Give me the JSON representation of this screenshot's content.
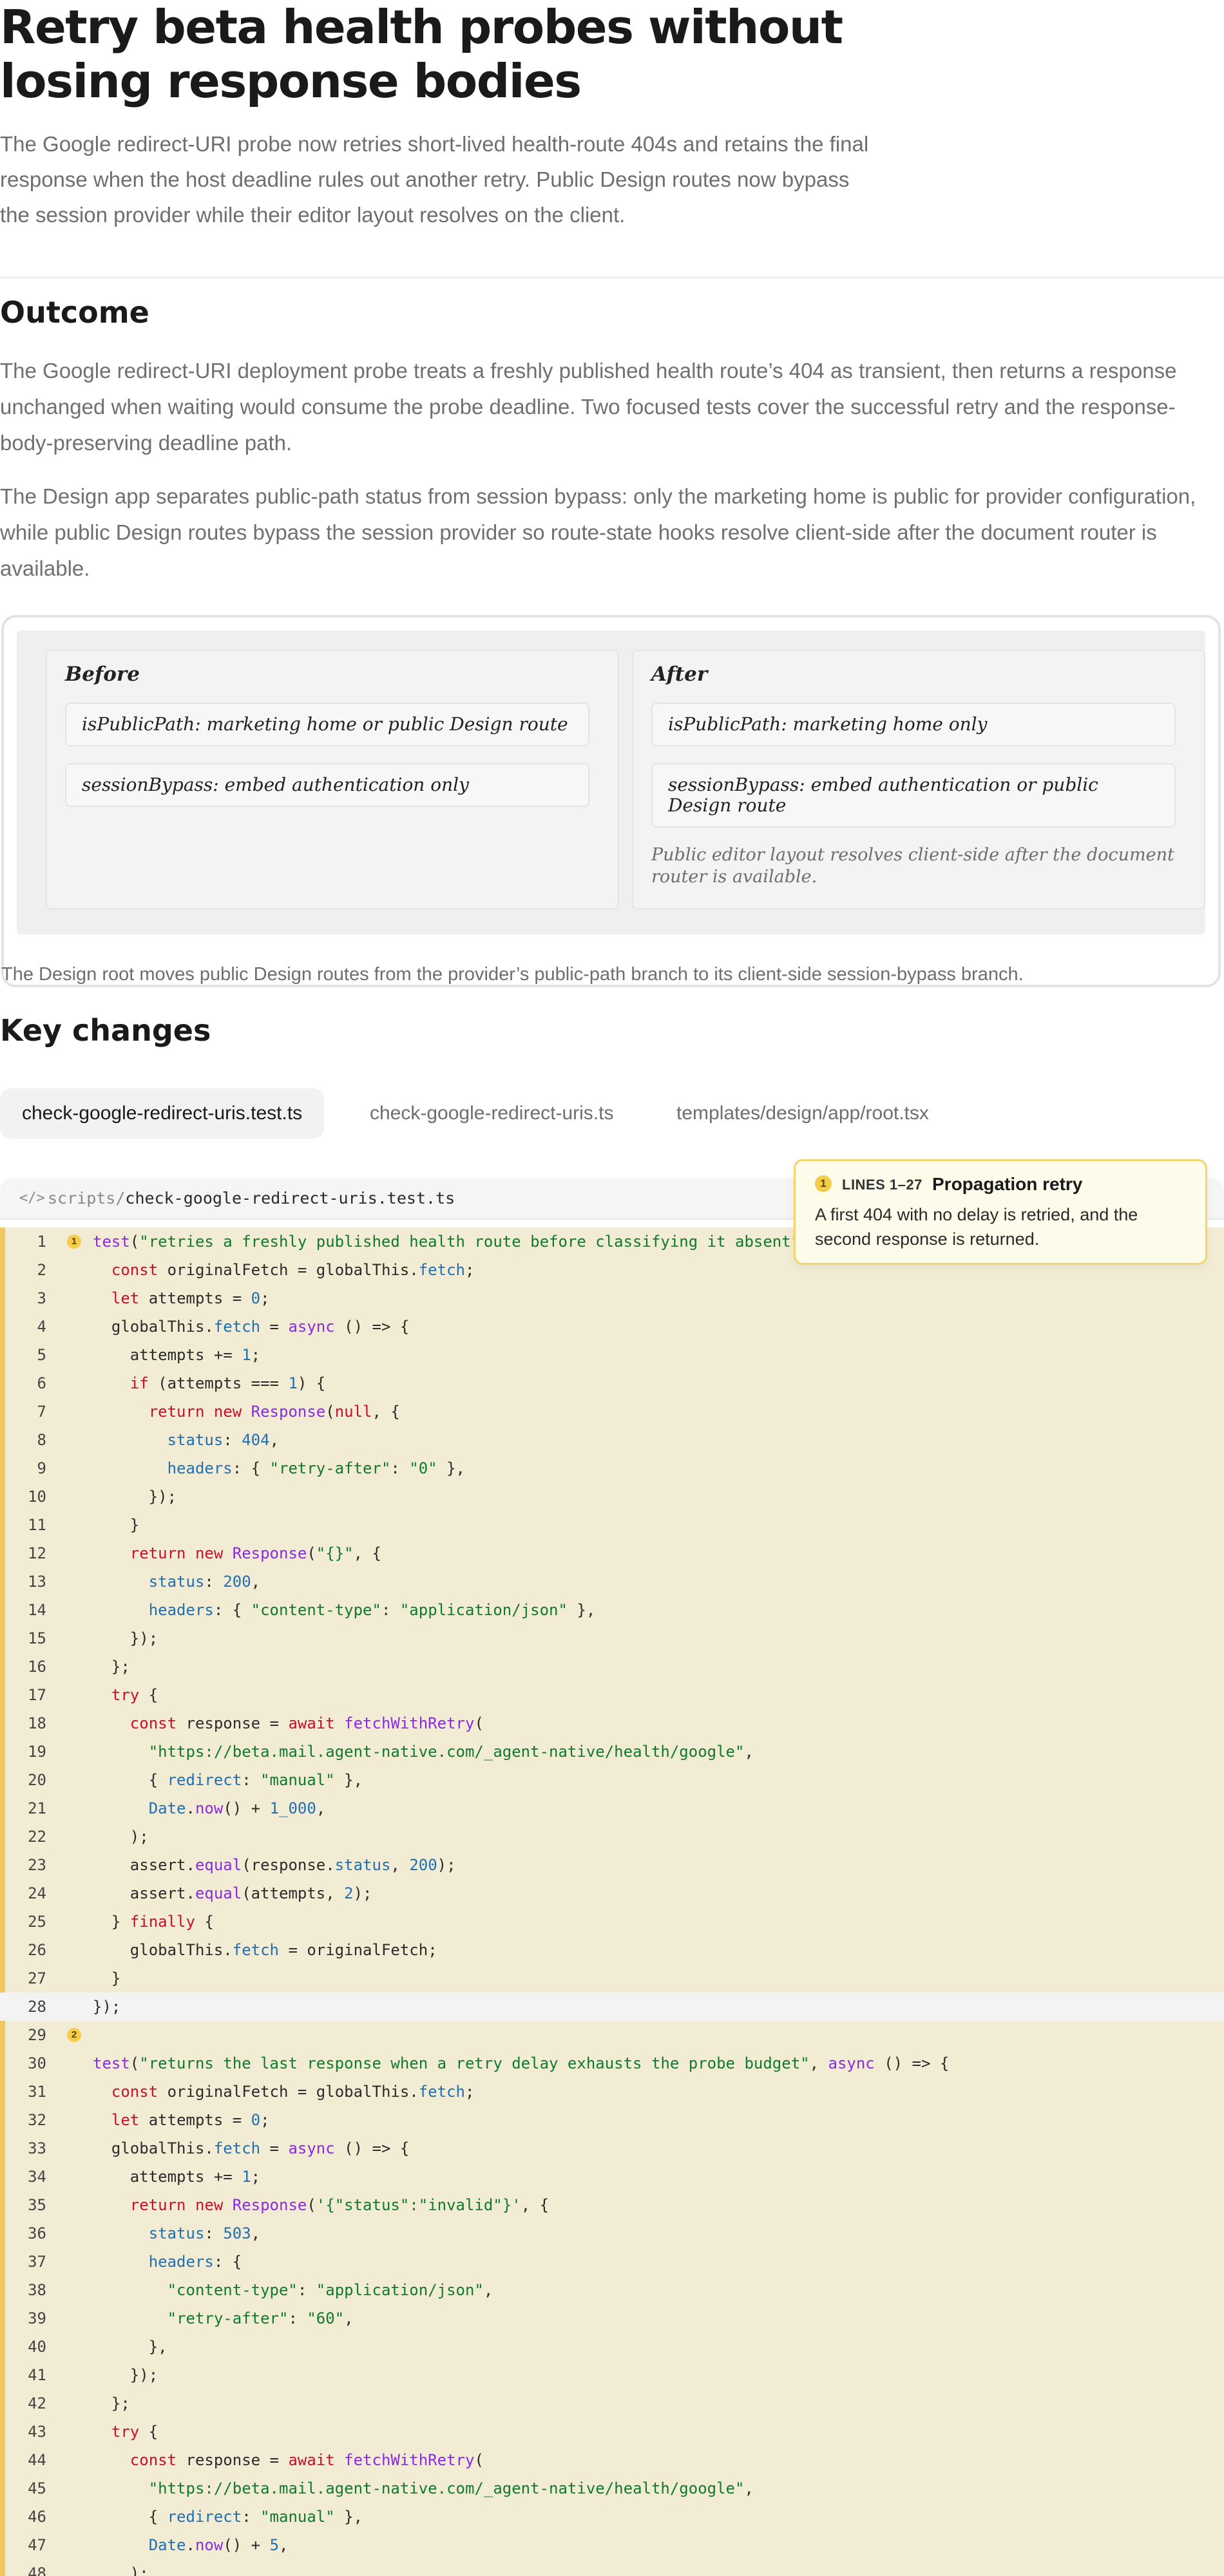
{
  "header": {
    "title": "Retry beta health probes without losing response bodies",
    "lede": "The Google redirect-URI probe now retries short-lived health-route 404s and retains the final response when the host deadline rules out another retry. Public Design routes now bypass the session provider while their editor layout resolves on the client."
  },
  "outcome": {
    "heading": "Outcome",
    "paragraphs": [
      "The Google redirect-URI deployment probe treats a freshly published health route’s 404 as transient, then returns a response unchanged when waiting would consume the probe deadline. Two focused tests cover the successful retry and the response-body-preserving deadline path.",
      "The Design app separates public-path status from session bypass: only the marketing home is public for provider configuration, while public Design routes bypass the session provider so route-state hooks resolve client-side after the document router is available."
    ]
  },
  "diagram": {
    "before": {
      "heading": "Before",
      "items": [
        "isPublicPath: marketing home or public Design route",
        "sessionBypass: embed authentication only"
      ]
    },
    "after": {
      "heading": "After",
      "items": [
        "isPublicPath: marketing home only",
        "sessionBypass: embed authentication or public Design route"
      ],
      "note": "Public editor layout resolves client-side after the document router is available."
    },
    "caption": "The Design root moves public Design routes from the provider’s public-path branch to its client-side session-bypass branch."
  },
  "key_changes": {
    "heading": "Key changes",
    "tabs": [
      "check-google-redirect-uris.test.ts",
      "check-google-redirect-uris.ts",
      "templates/design/app/root.tsx"
    ],
    "active_tab": 0
  },
  "code": {
    "icon": "code-icon",
    "path_dir": "scripts/",
    "path_file": "check-google-redirect-uris.test.ts",
    "colors": {
      "highlight_bg": "#f3ecd4",
      "highlight_bar": "#f1c760",
      "badge": "#f6cd4b"
    }
  },
  "callout": {
    "badge": "1",
    "range": "LINES 1–27",
    "title": "Propagation retry",
    "description": "A first 404 with no delay is retried, and the second response is returned."
  },
  "line_badges": {
    "1": "1",
    "29": "2"
  }
}
